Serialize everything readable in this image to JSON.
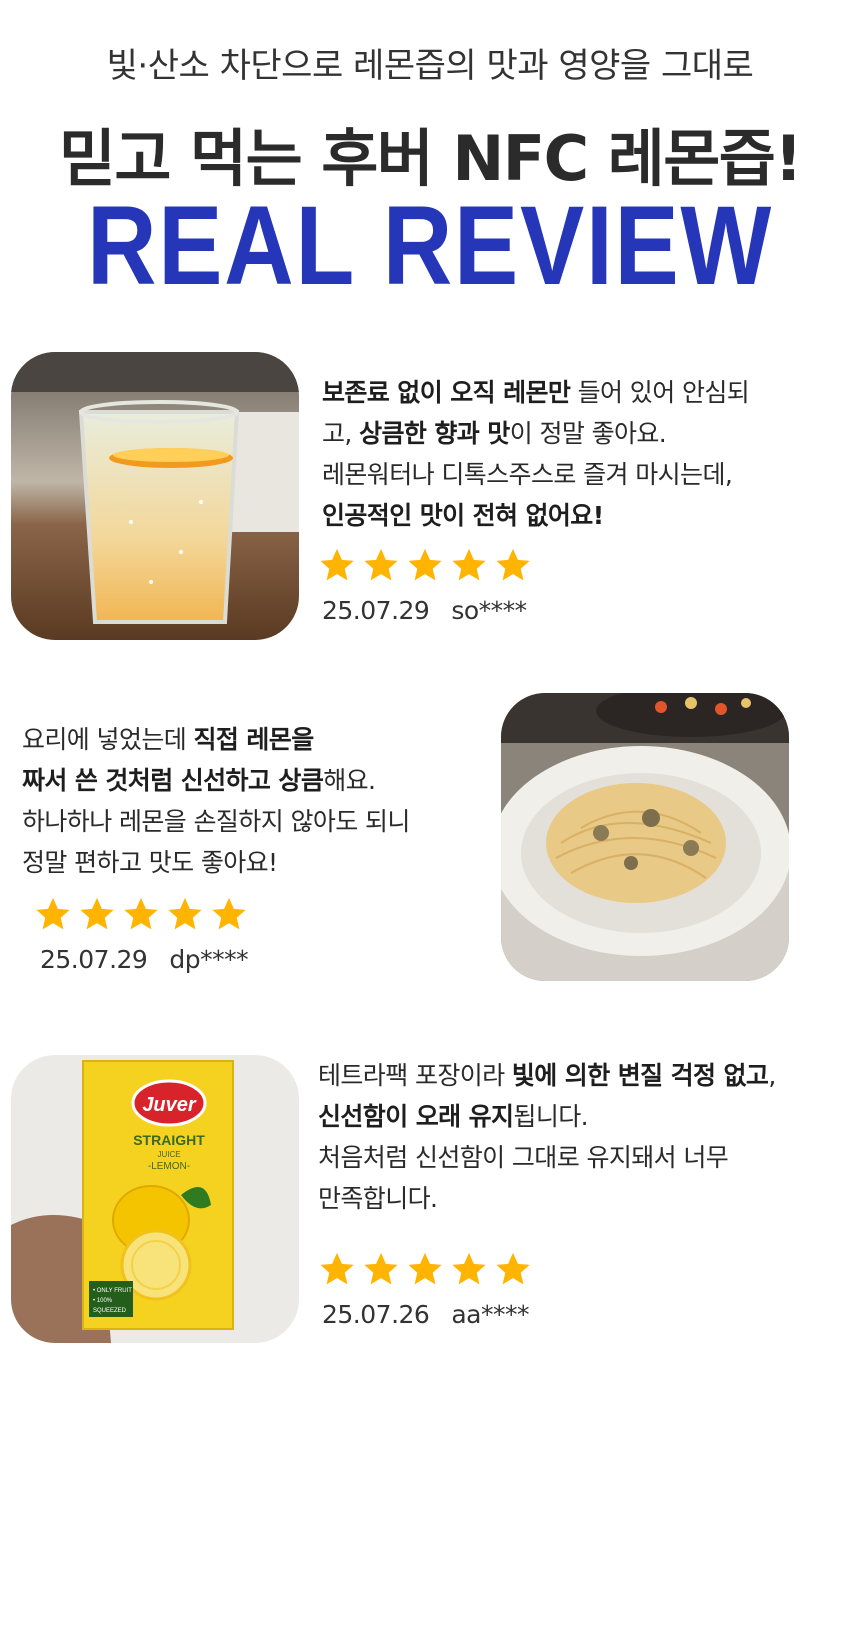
{
  "header": {
    "subtitle": "빛·산소 차단으로 레몬즙의 맛과 영양을 그대로",
    "title": "믿고 먹는 후버 NFC 레몬즙!",
    "section_title": "REAL REVIEW",
    "accent_color": "#2536b8"
  },
  "reviews": [
    {
      "lines": [
        [
          {
            "t": "보존료 없이 오직 레몬만",
            "b": true
          },
          {
            "t": " 들어 있어 안심되",
            "b": false
          }
        ],
        [
          {
            "t": "고, ",
            "b": false
          },
          {
            "t": "상큼한 향과 맛",
            "b": true
          },
          {
            "t": "이 정말 좋아요.",
            "b": false
          }
        ],
        [
          {
            "t": "레몬워터나 디톡스주스로 즐겨 마시는데,",
            "b": false
          }
        ],
        [
          {
            "t": "인공적인 맛이 전혀 없어요!",
            "b": true
          }
        ]
      ],
      "rating": 5,
      "date": "25.07.29",
      "user": "so****",
      "photo_icon": "lemon-water-glass"
    },
    {
      "lines": [
        [
          {
            "t": "요리에 넣었는데 ",
            "b": false
          },
          {
            "t": "직접 레몬을",
            "b": true
          }
        ],
        [
          {
            "t": "짜서 쓴 것처럼 신선하고 상큼",
            "b": true
          },
          {
            "t": "해요.",
            "b": false
          }
        ],
        [
          {
            "t": "하나하나 레몬을 손질하지 않아도 되니",
            "b": false
          }
        ],
        [
          {
            "t": "정말 편하고 맛도 좋아요!",
            "b": false
          }
        ]
      ],
      "rating": 5,
      "date": "25.07.29",
      "user": "dp****",
      "photo_icon": "pasta-plate"
    },
    {
      "lines": [
        [
          {
            "t": "테트라팩 포장이라 ",
            "b": false
          },
          {
            "t": "빛에 의한 변질 걱정 없고",
            "b": true
          },
          {
            "t": ",",
            "b": false
          }
        ],
        [
          {
            "t": "신선함이 오래 유지",
            "b": true
          },
          {
            "t": "됩니다.",
            "b": false
          }
        ],
        [
          {
            "t": "처음처럼 신선함이 그대로 유지돼서 너무",
            "b": false
          }
        ],
        [
          {
            "t": "만족합니다.",
            "b": false
          }
        ]
      ],
      "rating": 5,
      "date": "25.07.26",
      "user": "aa****",
      "photo_icon": "juice-carton",
      "carton": {
        "brand": "Juver",
        "line1": "STRAIGHT",
        "line2": "JUICE",
        "line3": "-LEMON-",
        "badge1": "• ONLY FRUIT",
        "badge2": "• 100%",
        "badge3": "SQUEEZED"
      }
    }
  ],
  "star_color": "#ffb400"
}
